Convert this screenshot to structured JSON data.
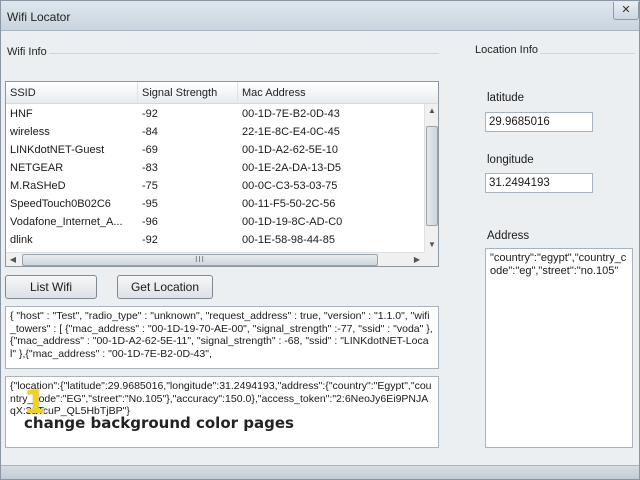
{
  "window": {
    "title": "Wifi Locator",
    "close_label": "✕"
  },
  "wifi_info": {
    "group_label": "Wifi Info",
    "columns": [
      "SSID",
      "Signal Strength",
      "Mac Address"
    ],
    "rows": [
      {
        "ssid": "HNF",
        "signal": "-92",
        "mac": "00-1D-7E-B2-0D-43"
      },
      {
        "ssid": "wireless",
        "signal": "-84",
        "mac": "22-1E-8C-E4-0C-45"
      },
      {
        "ssid": "LINKdotNET-Guest",
        "signal": "-69",
        "mac": "00-1D-A2-62-5E-10"
      },
      {
        "ssid": "NETGEAR",
        "signal": "-83",
        "mac": "00-1E-2A-DA-13-D5"
      },
      {
        "ssid": "M.RaSHeD",
        "signal": "-75",
        "mac": "00-0C-C3-53-03-75"
      },
      {
        "ssid": "SpeedTouch0B02C6",
        "signal": "-95",
        "mac": "00-11-F5-50-2C-56"
      },
      {
        "ssid": "Vodafone_Internet_A...",
        "signal": "-96",
        "mac": "00-1D-19-8C-AD-C0"
      },
      {
        "ssid": "dlink",
        "signal": "-92",
        "mac": "00-1E-58-98-44-85"
      }
    ],
    "scroll_grip": "III"
  },
  "buttons": {
    "list_wifi": "List Wifi",
    "get_location": "Get Location"
  },
  "request_text": "{ \"host\" : \"Test\", \"radio_type\" : \"unknown\", \"request_address\" : true, \"version\" : \"1.1.0\", \"wifi_towers\" : [ {\"mac_address\" : \"00-1D-19-70-AE-00\", \"signal_strength\" :-77, \"ssid\" : \"voda\" },{\"mac_address\" : \"00-1D-A2-62-5E-11\", \"signal_strength\" : -68, \"ssid\" : \"LINKdotNET-Local\" },{\"mac_address\" : \"00-1D-7E-B2-0D-43\",",
  "response_text": "{\"location\":{\"latitude\":29.9685016,\"longitude\":31.2494193,\"address\":{\"country\":\"Egypt\",\"country_code\":\"EG\",\"street\":\"No.105\"},\"accuracy\":150.0},\"access_token\":\"2:6NeoJy6Ei9PNJAqX:3aTcuP_QL5HbTjBP\"}",
  "location_info": {
    "group_label": "Location Info",
    "latitude_label": "latitude",
    "latitude_value": "29.9685016",
    "longitude_label": "longitude",
    "longitude_value": "31.2494193",
    "address_label": "Address",
    "address_value": "\"country\":\"egypt\",\"country_code\":\"eg\",\"street\":\"no.105\""
  },
  "overlay": {
    "number": "1",
    "caption": "change background color pages"
  }
}
